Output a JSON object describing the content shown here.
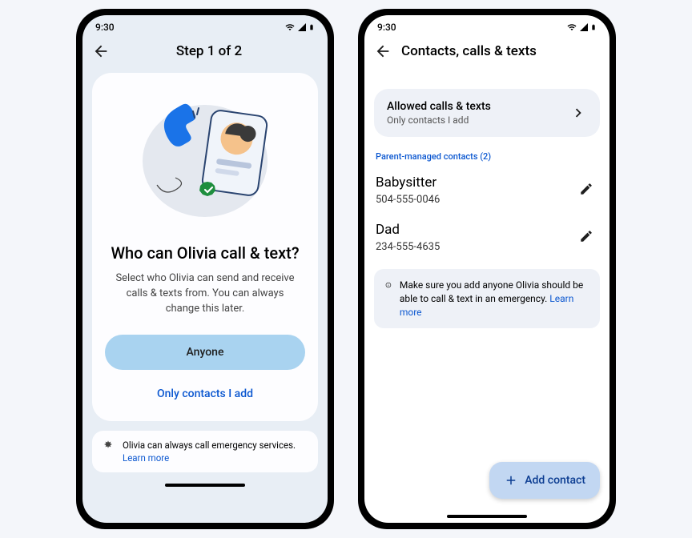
{
  "status": {
    "time": "9:30"
  },
  "phone1": {
    "step": "Step 1 of 2",
    "title": "Who can Olivia call & text?",
    "description": "Select who Olivia can send and receive calls & texts from. You can always change this later.",
    "primary_btn": "Anyone",
    "secondary_btn": "Only contacts I add",
    "note_text": "Olivia can always call emergency services. ",
    "note_link": "Learn more"
  },
  "phone2": {
    "title": "Contacts, calls & texts",
    "setting": {
      "title": "Allowed calls & texts",
      "subtitle": "Only contacts I add"
    },
    "section_label": "Parent-managed contacts (2)",
    "contacts": [
      {
        "name": "Babysitter",
        "number": "504-555-0046"
      },
      {
        "name": "Dad",
        "number": "234-555-4635"
      }
    ],
    "info_text": "Make sure you add anyone Olivia should be able to call & text in an emergency. ",
    "info_link": "Learn more",
    "fab_label": "Add contact"
  }
}
